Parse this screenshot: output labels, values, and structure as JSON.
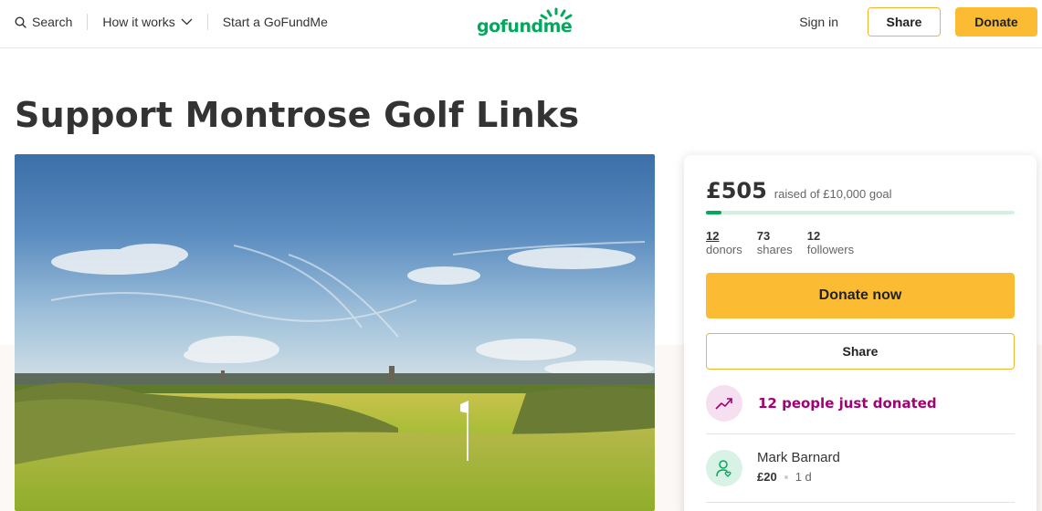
{
  "nav": {
    "search_label": "Search",
    "how_it_works_label": "How it works",
    "start_label": "Start a GoFundMe",
    "logo_text": "gofundme",
    "signin_label": "Sign in",
    "share_label": "Share",
    "donate_label": "Donate"
  },
  "campaign": {
    "title": "Support Montrose Golf Links"
  },
  "donation": {
    "raised": "£505",
    "goal_text": "raised of £10,000 goal",
    "progress_fraction": 0.0505,
    "stats": [
      {
        "value": "12",
        "label": "donors"
      },
      {
        "value": "73",
        "label": "shares"
      },
      {
        "value": "12",
        "label": "followers"
      }
    ],
    "donate_now_label": "Donate now",
    "share_label": "Share",
    "trending_text": "12 people just donated",
    "recent_donor": {
      "name": "Mark Barnard",
      "amount": "£20",
      "time": "1 d"
    }
  },
  "colors": {
    "brand_green": "#02a95c",
    "button_yellow": "#fbbb32",
    "trending_purple": "#a30073"
  },
  "icons": [
    "search-icon",
    "chevron-down-icon",
    "trending-up-icon",
    "donor-heart-icon"
  ]
}
